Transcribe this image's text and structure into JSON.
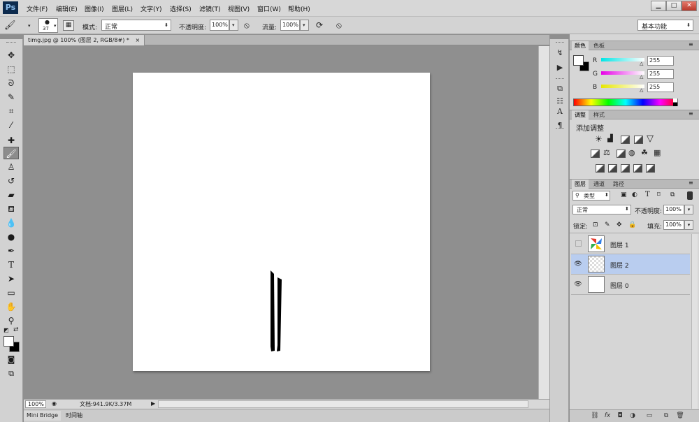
{
  "app": {
    "logo": "Ps"
  },
  "menu": [
    "文件(F)",
    "编辑(E)",
    "图像(I)",
    "图层(L)",
    "文字(Y)",
    "选择(S)",
    "滤镜(T)",
    "视图(V)",
    "窗口(W)",
    "帮助(H)"
  ],
  "window_controls": {
    "minimize": "▁",
    "maximize": "□",
    "close": "✕"
  },
  "options_bar": {
    "brush_size": "37",
    "mode_label": "模式:",
    "mode_value": "正常",
    "opacity_label": "不透明度:",
    "opacity_value": "100%",
    "flow_label": "流量:",
    "flow_value": "100%",
    "workspace": "基本功能"
  },
  "document": {
    "tab_title": "timg.jpg @ 100% (图层 2, RGB/8#) *",
    "tab_close": "×"
  },
  "status": {
    "zoom": "100%",
    "doc_info": "文档:941.9K/3.37M"
  },
  "bottom_tabs": [
    "Mini Bridge",
    "时间轴"
  ],
  "color_panel": {
    "tabs": [
      "颜色",
      "色板"
    ],
    "channels": [
      {
        "label": "R",
        "value": "255",
        "color": "#00e5e5"
      },
      {
        "label": "G",
        "value": "255",
        "color": "#e600e6"
      },
      {
        "label": "B",
        "value": "255",
        "color": "#e6e600"
      }
    ]
  },
  "adjust_panel": {
    "tabs": [
      "调整",
      "样式"
    ],
    "heading": "添加调整"
  },
  "layers_panel": {
    "tabs": [
      "图层",
      "通道",
      "路径"
    ],
    "filter": "类型",
    "blend": "正常",
    "opacity_label": "不透明度:",
    "opacity_value": "100%",
    "lock_label": "锁定:",
    "fill_label": "填充:",
    "fill_value": "100%",
    "layers": [
      {
        "name": "图层 1",
        "visible": false,
        "selected": false
      },
      {
        "name": "图层 2",
        "visible": true,
        "selected": true
      },
      {
        "name": "图层 0",
        "visible": true,
        "selected": false
      }
    ],
    "footer_icons": [
      "link-icon",
      "fx-icon",
      "mask-icon",
      "adjustment-icon",
      "folder-icon",
      "new-layer-icon",
      "trash-icon"
    ]
  }
}
